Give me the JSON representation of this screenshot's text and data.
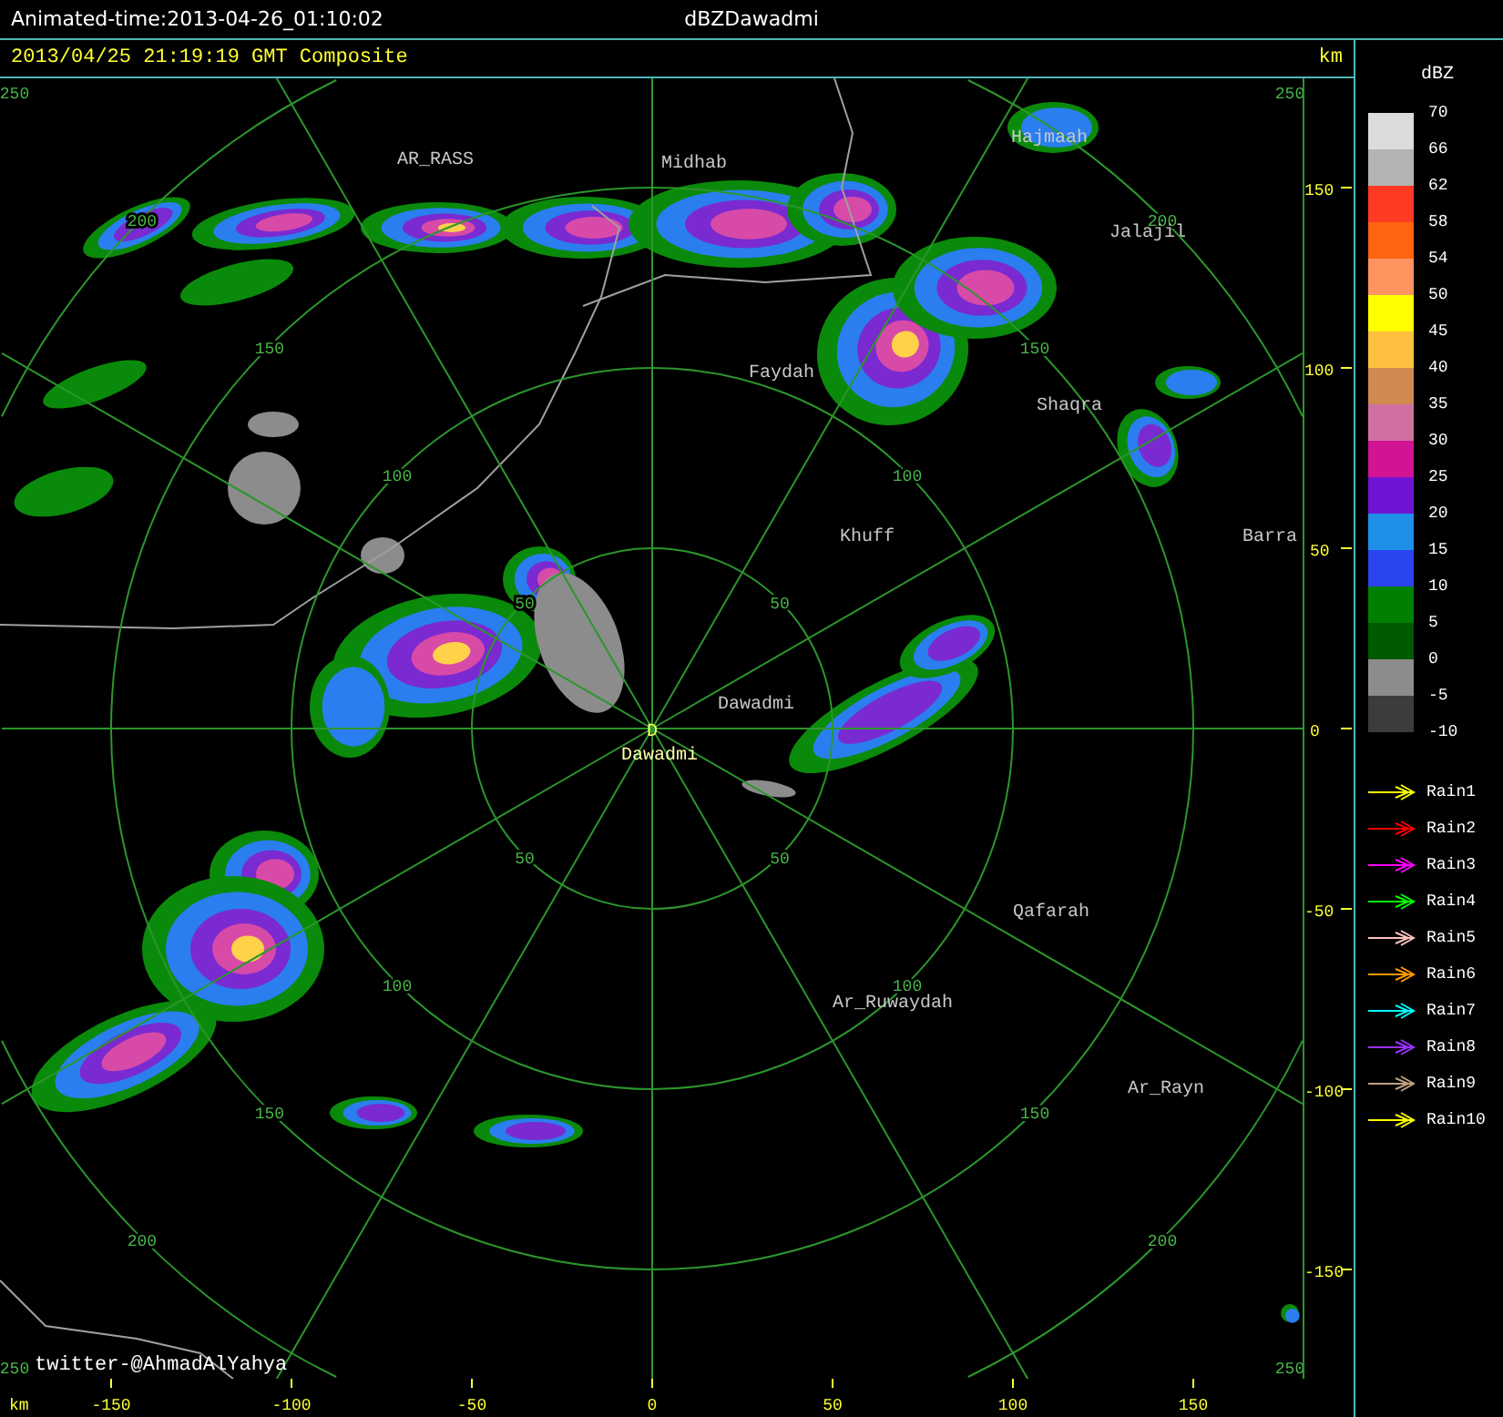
{
  "header": {
    "animated_time": "Animated-time:2013-04-26_01:10:02",
    "title": "dBZDawadmi"
  },
  "subheader": {
    "timestamp": "2013/04/25 21:19:19 GMT Composite",
    "unit": "km"
  },
  "radar": {
    "site_marker": "D",
    "site_name": "Dawadmi",
    "range_rings": [
      {
        "labels": [
          "50",
          "50",
          "50",
          "50"
        ]
      },
      {
        "labels": [
          "100",
          "100",
          "100",
          "100"
        ]
      },
      {
        "labels": [
          "150",
          "150",
          "150",
          "150"
        ]
      },
      {
        "labels": [
          "200",
          "200",
          "200",
          "200"
        ]
      },
      {
        "labels": [
          "250",
          "250",
          "250",
          "250"
        ]
      }
    ],
    "places": [
      "AR_RASS",
      "Midhab",
      "Hajmaah",
      "Jalajil",
      "Faydah",
      "Shaqra",
      "Barra",
      "Khuff",
      "Dawadmi",
      "Qafarah",
      "Ar_Ruwaydah",
      "Ar_Rayn"
    ],
    "credit": "twitter-@AhmadAlYahya"
  },
  "y_axis": {
    "ticks": [
      "150",
      "100",
      "50",
      "0",
      "-50",
      "-100",
      "-150"
    ]
  },
  "x_axis": {
    "unit": "km",
    "ticks": [
      "-150",
      "-100",
      "-50",
      "0",
      "50",
      "100",
      "150"
    ]
  },
  "legend": {
    "unit": "dBZ",
    "scale_labels": [
      "70",
      "66",
      "62",
      "58",
      "54",
      "50",
      "45",
      "40",
      "35",
      "30",
      "25",
      "20",
      "15",
      "10",
      "5",
      "0",
      "-5",
      "-10"
    ],
    "scale_bins": [
      {
        "color": "#dcdcdc"
      },
      {
        "color": "#b4b4b4"
      },
      {
        "color": "#ff3a22"
      },
      {
        "color": "#ff6410"
      },
      {
        "color": "#ff9460"
      },
      {
        "color": "#ffff00"
      },
      {
        "color": "#ffc040"
      },
      {
        "color": "#d08a50"
      },
      {
        "color": "#d070a0"
      },
      {
        "color": "#d01494"
      },
      {
        "color": "#7014d4"
      },
      {
        "color": "#1e90e8"
      },
      {
        "color": "#2a44f0"
      },
      {
        "color": "#008000"
      },
      {
        "color": "#005a00"
      },
      {
        "color": "#8c8c8c"
      },
      {
        "color": "#3c3c3c"
      }
    ],
    "tracks": [
      {
        "label": "Rain1",
        "color": "#ffff00"
      },
      {
        "label": "Rain2",
        "color": "#ff0000"
      },
      {
        "label": "Rain3",
        "color": "#ff00ff"
      },
      {
        "label": "Rain4",
        "color": "#00ff00"
      },
      {
        "label": "Rain5",
        "color": "#ffc0c0"
      },
      {
        "label": "Rain6",
        "color": "#ff9900"
      },
      {
        "label": "Rain7",
        "color": "#00ffff"
      },
      {
        "label": "Rain8",
        "color": "#9933ff"
      },
      {
        "label": "Rain9",
        "color": "#c0a080"
      },
      {
        "label": "Rain10",
        "color": "#ffff00"
      }
    ]
  }
}
